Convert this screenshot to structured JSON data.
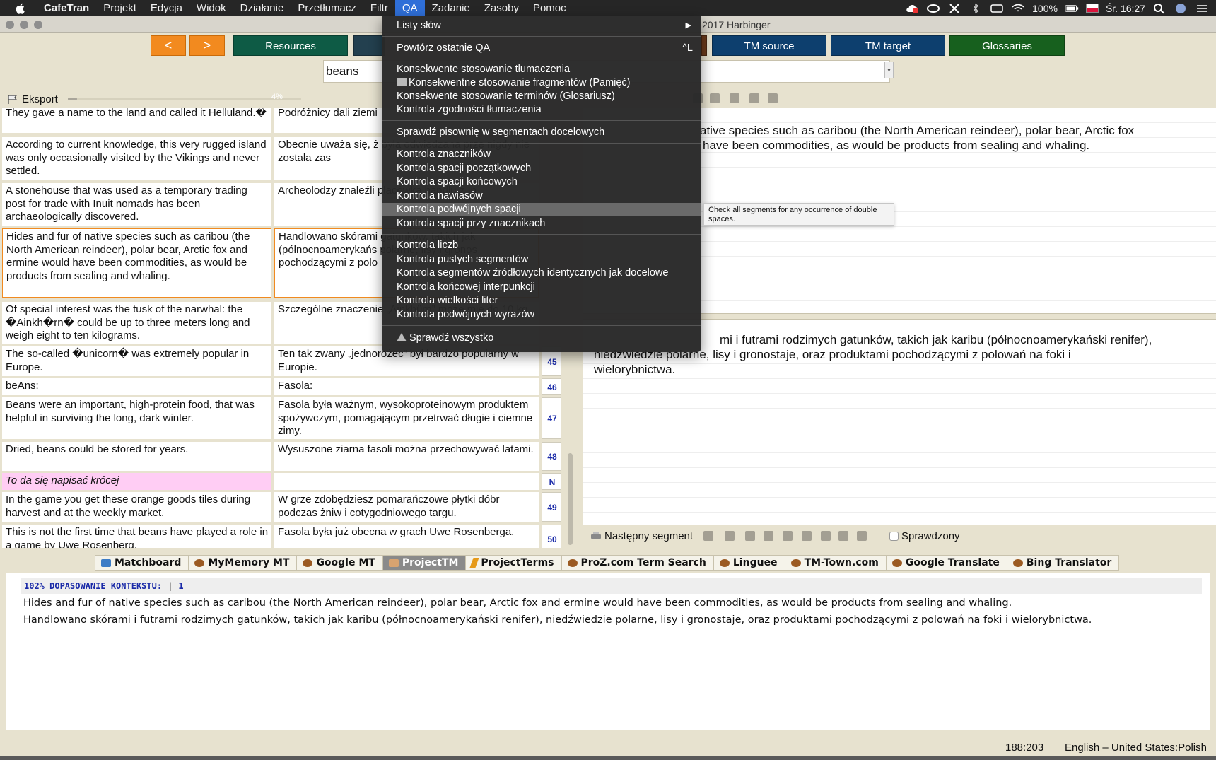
{
  "menubar": {
    "app_name": "CafeTran",
    "items": [
      "Projekt",
      "Edycja",
      "Widok",
      "Działanie",
      "Przetłumacz",
      "Filtr",
      "QA",
      "Zadanie",
      "Zasoby",
      "Pomoc"
    ],
    "active_item": "QA",
    "battery": "100%",
    "clock": "Śr. 16:27"
  },
  "window": {
    "title_fragment": "2017 Harbinger"
  },
  "toolbar": {
    "prev_label": "<",
    "next_label": ">",
    "buttons": [
      {
        "label": "Resources",
        "color": "#0e5b45"
      },
      {
        "label": "",
        "color": "#23404f"
      },
      {
        "label": "TM source",
        "color": "#0d3f6e"
      },
      {
        "label": "TM target",
        "color": "#0d3f6e"
      },
      {
        "label": "Glossaries",
        "color": "#17601e"
      }
    ]
  },
  "search": {
    "value": "beans"
  },
  "grid_header": {
    "label": "Eksport",
    "progress_percent": 4,
    "progress_label": "4%"
  },
  "grid": {
    "rows": [
      {
        "source": "They gave a name to the land and called it Helluland.�",
        "target": "Podróżnicy dali ziemi",
        "num": ""
      },
      {
        "source": "According to current knowledge, this very rugged island was only occasionally visited by the Vikings and never settled.",
        "target": "Obecnie uważa się, ż była odwiedzana prze nigdy nie została zas",
        "num": ""
      },
      {
        "source": "A stonehouse that was used as a temporary trading post for trade with Inuit nomads has been archaeologically discovered.",
        "target": "Archeolodzy znaleźli placówką handlu z In",
        "num": ""
      },
      {
        "source": "Hides and fur of native species such as caribou (the North American reindeer), polar bear, Arctic fox and ermine would have been commodities, as would be products from sealing and whaling.",
        "target": "Handlowano skórami gatunków, takich jak (północnoamerykańs polarne, lisy i gronos pochodzącymi z polo",
        "num": ""
      },
      {
        "source": "Of special interest was the tusk of the narwhal: the �Ainkh�rn� could be up to three meters long and weigh eight to ten kilograms.",
        "target": "Szczególne znaczenie „Ainkhürn” może mie do 10 kg.",
        "num": ""
      },
      {
        "source": "The so-called �unicorn� was extremely popular in Europe.",
        "target": "Ten tak zwany „jednorożec” był bardzo popularny w Europie.",
        "num": "45"
      },
      {
        "source": "beAns:",
        "target": "Fasola:",
        "num": "46"
      },
      {
        "source": "Beans were an important, high-protein food, that was helpful in surviving the long, dark winter.",
        "target": "Fasola była ważnym, wysokoproteinowym produktem spożywczym, pomagającym przetrwać długie i ciemne zimy.",
        "num": "47"
      },
      {
        "source": "Dried, beans could be stored for years.",
        "target": "Wysuszone ziarna fasoli można przechowywać latami.",
        "num": "48"
      },
      {
        "source": "To da się napisać krócej",
        "target": "",
        "num": "N"
      },
      {
        "source": "In the game you get these orange goods tiles during harvest and at the weekly market.",
        "target": "W grze zdobędziesz pomarańczowe płytki dóbr podczas żniw i cotygodniowego targu.",
        "num": "49"
      },
      {
        "source": "This is not the first time that beans have played a role in a game by Uwe Rosenberg.",
        "target": "Fasola była już obecna w grach Uwe Rosenberga.",
        "num": "50"
      }
    ]
  },
  "editor": {
    "source_line1": "ative species such as caribou (the North American reindeer), polar bear, Arctic fox",
    "source_line2": "have been commodities, as would be products from sealing and whaling.",
    "target_line1": "mi i futrami rodzimych gatunków, takich jak karibu (północnoamerykański renifer),",
    "target_line2": "niedźwiedzie polarne, lisy i gronostaje, oraz produktami pochodzącymi z polowań na foki i",
    "target_line3": "wielorybnictwa.",
    "next_segment_label": "Następny segment",
    "checked_label": "Sprawdzony"
  },
  "qa_menu": {
    "items": [
      {
        "label": "Listy słów",
        "submenu": "▶"
      },
      {
        "label": "Powtórz ostatnie QA",
        "shortcut": "^L"
      },
      {
        "label": "Konsekwente stosowanie tłumaczenia"
      },
      {
        "label": "Konsekwentne stosowanie fragmentów (Pamięć)"
      },
      {
        "label": "Konsekwente stosowanie terminów (Glosariusz)"
      },
      {
        "label": "Kontrola zgodności tłumaczenia"
      },
      {
        "label": "Sprawdź pisownię w segmentach docelowych"
      },
      {
        "label": "Kontrola znaczników"
      },
      {
        "label": "Kontrola spacji początkowych"
      },
      {
        "label": "Kontrola spacji końcowych"
      },
      {
        "label": "Kontrola nawiasów"
      },
      {
        "label": "Kontrola podwójnych spacji"
      },
      {
        "label": "Kontrola spacji przy znacznikach"
      },
      {
        "label": "Kontrola liczb"
      },
      {
        "label": "Kontrola pustych segmentów"
      },
      {
        "label": "Kontrola segmentów źródłowych identycznych jak docelowe"
      },
      {
        "label": "Kontrola końcowej interpunkcji"
      },
      {
        "label": "Kontrola wielkości liter"
      },
      {
        "label": "Kontrola podwójnych wyrazów"
      },
      {
        "label": "Sprawdź wszystko"
      }
    ],
    "highlighted": "Kontrola podwójnych spacji",
    "tooltip": "Check all segments for any occurrence of double spaces."
  },
  "tabs": [
    "Matchboard",
    "MyMemory MT",
    "Google MT",
    "ProjectTM",
    "ProjectTerms",
    "ProZ.com Term Search",
    "Linguee",
    "TM-Town.com",
    "Google Translate",
    "Bing Translator"
  ],
  "selected_tab": "ProjectTM",
  "match": {
    "header": "102% DOPASOWANIE KONTEKSTU:",
    "sep": "|",
    "count": "1",
    "source": "Hides and fur of native species such as caribou (the North American reindeer), polar bear, Arctic fox and ermine would have been commodities, as would be products from sealing and whaling.",
    "target": "Handlowano skórami i futrami rodzimych gatunków, takich jak karibu (północnoamerykański renifer), niedźwiedzie polarne, lisy i gronostaje, oraz produktami pochodzącymi z polowań na foki i wielorybnictwa."
  },
  "statusbar": {
    "position": "188:203",
    "language": "English – United States:Polish"
  }
}
